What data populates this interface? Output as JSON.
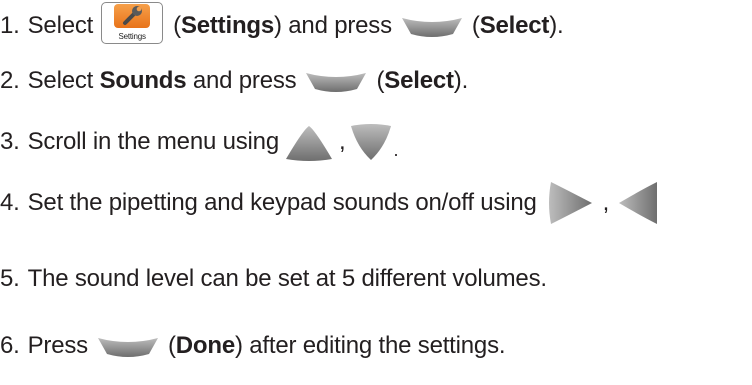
{
  "steps": [
    {
      "num": "1.",
      "t1": "Select",
      "b1": "Settings",
      "t2": "and press",
      "b2": "Select",
      "icon_label": "Settings"
    },
    {
      "num": "2.",
      "t1": "Select",
      "b1": "Sounds",
      "t2": "and press",
      "b2": "Select"
    },
    {
      "num": "3.",
      "t1": "Scroll in the menu using"
    },
    {
      "num": "4.",
      "t1": "Set the pipetting and keypad sounds on/off using"
    },
    {
      "num": "5.",
      "t1": "The sound level can be set at 5 different volumes."
    },
    {
      "num": "6.",
      "t1": "Press",
      "b1": "Done",
      "t2": "after editing the settings."
    }
  ],
  "icons": {
    "settings_tile": "settings-wrench-icon",
    "select_key": "select-key-icon",
    "up": "up-arrow-key-icon",
    "down": "down-arrow-key-icon",
    "right": "right-arrow-key-icon",
    "left": "left-arrow-key-icon"
  },
  "colors": {
    "text": "#231f20",
    "settings_tile": "#e8731a",
    "key_gray": "#9a9a9a"
  }
}
